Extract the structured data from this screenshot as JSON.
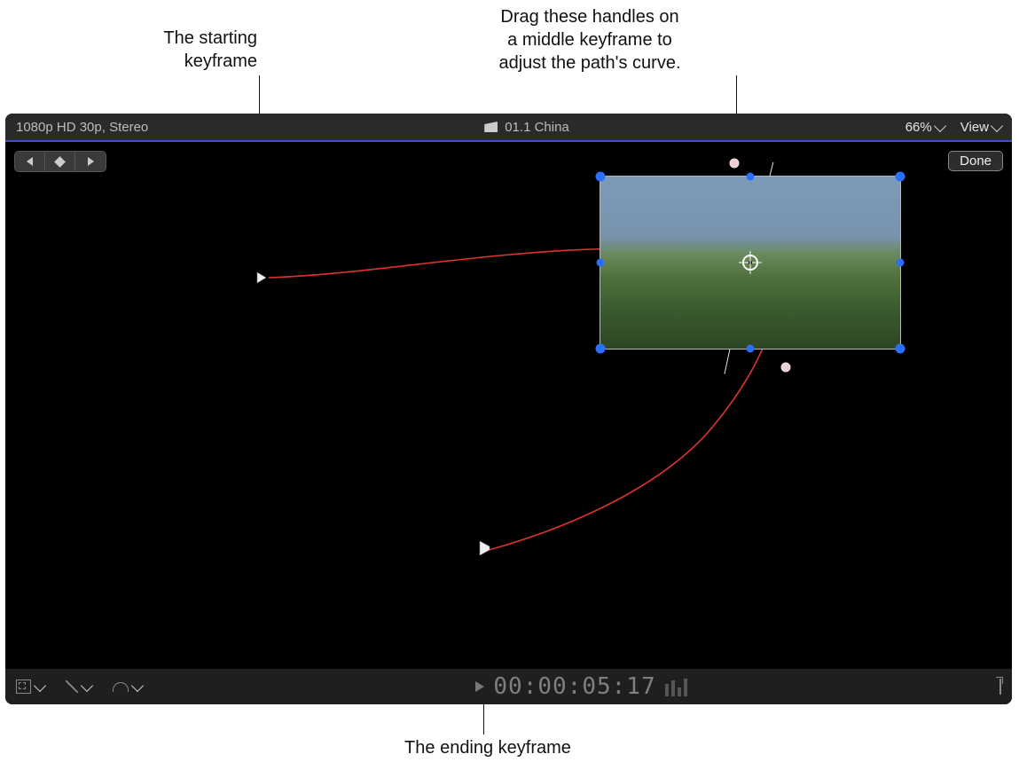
{
  "callouts": {
    "start": "The starting\nkeyframe",
    "handles": "Drag these handles on\na middle keyframe to\nadjust the path's curve.",
    "end": "The ending keyframe"
  },
  "titlebar": {
    "format": "1080p HD 30p, Stereo",
    "clip_name": "01.1 China",
    "zoom": "66%",
    "view": "View"
  },
  "controls": {
    "done": "Done"
  },
  "timecode": "00:00:05:17"
}
